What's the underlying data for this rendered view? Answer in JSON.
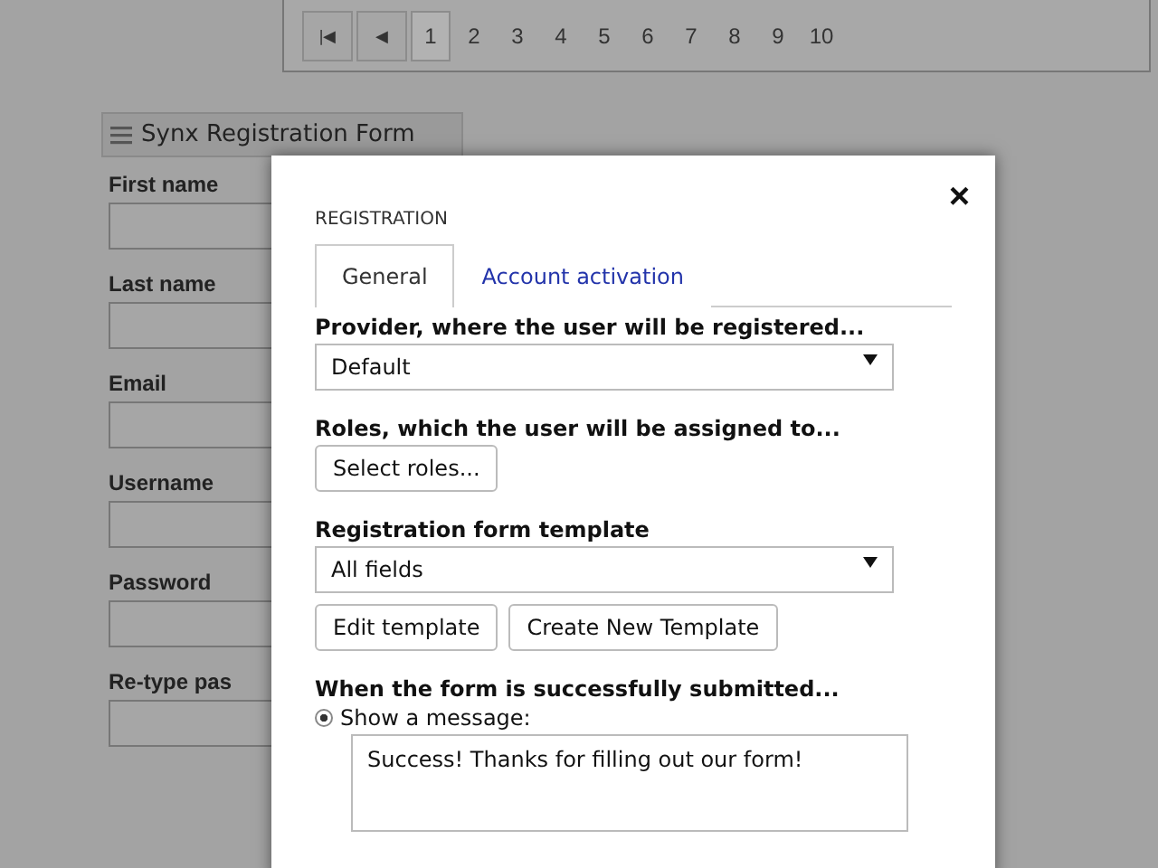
{
  "pager": {
    "first": "|◀",
    "prev": "◀",
    "pages": [
      {
        "label": "1",
        "selected": true
      },
      {
        "label": "2",
        "selected": false
      },
      {
        "label": "3",
        "selected": false
      },
      {
        "label": "4",
        "selected": false
      },
      {
        "label": "5",
        "selected": false
      },
      {
        "label": "6",
        "selected": false
      },
      {
        "label": "7",
        "selected": false
      },
      {
        "label": "8",
        "selected": false
      },
      {
        "label": "9",
        "selected": false
      },
      {
        "label": "10",
        "selected": false
      }
    ]
  },
  "form": {
    "title": "Synx Registration Form",
    "fields": [
      "First name",
      "Last name",
      "Email",
      "Username",
      "Password",
      "Re-type pas"
    ]
  },
  "dialog": {
    "close": "×",
    "heading": "REGISTRATION",
    "tabs": [
      {
        "label": "General",
        "selected": true
      },
      {
        "label": "Account activation",
        "selected": false
      }
    ],
    "provider": {
      "label": "Provider, where the user will be registered...",
      "value": "Default"
    },
    "roles": {
      "label": "Roles, which the user will be assigned to...",
      "button": "Select roles..."
    },
    "template": {
      "label": "Registration form template",
      "value": "All fields",
      "buttons": [
        "Edit template",
        "Create New Template"
      ]
    },
    "submitted": {
      "label": "When the form is successfully submitted...",
      "option": {
        "label": "Show a message:",
        "selected": true
      },
      "message": "Success! Thanks for filling out our form!"
    }
  }
}
